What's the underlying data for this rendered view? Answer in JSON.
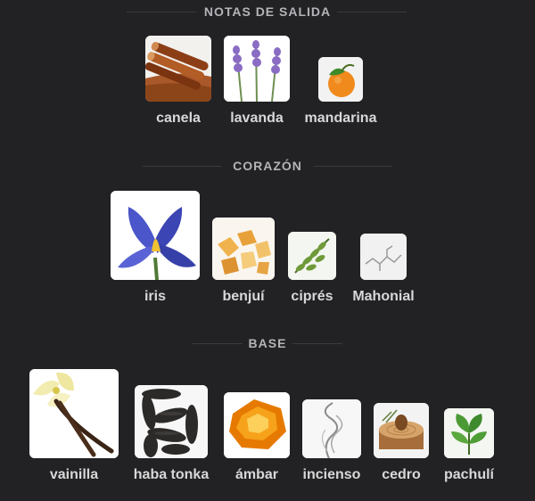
{
  "sections": {
    "top": {
      "title": "NOTAS DE SALIDA",
      "notes": [
        {
          "label": "canela",
          "icon": "cinnamon-icon"
        },
        {
          "label": "lavanda",
          "icon": "lavender-icon"
        },
        {
          "label": "mandarina",
          "icon": "mandarin-icon"
        }
      ]
    },
    "heart": {
      "title": "CORAZÓN",
      "notes": [
        {
          "label": "iris",
          "icon": "iris-icon"
        },
        {
          "label": "benjuí",
          "icon": "benzoin-icon"
        },
        {
          "label": "ciprés",
          "icon": "cypress-icon"
        },
        {
          "label": "Mahonial",
          "icon": "molecule-icon"
        }
      ]
    },
    "base": {
      "title": "BASE",
      "notes": [
        {
          "label": "vainilla",
          "icon": "vanilla-icon"
        },
        {
          "label": "haba tonka",
          "icon": "tonka-bean-icon"
        },
        {
          "label": "ámbar",
          "icon": "amber-icon"
        },
        {
          "label": "incienso",
          "icon": "incense-icon"
        },
        {
          "label": "cedro",
          "icon": "cedar-icon"
        },
        {
          "label": "pachulí",
          "icon": "patchouli-icon"
        }
      ]
    }
  },
  "colors": {
    "background": "#222225",
    "label": "#d8d8d8",
    "section_title": "#b4b4b8"
  }
}
